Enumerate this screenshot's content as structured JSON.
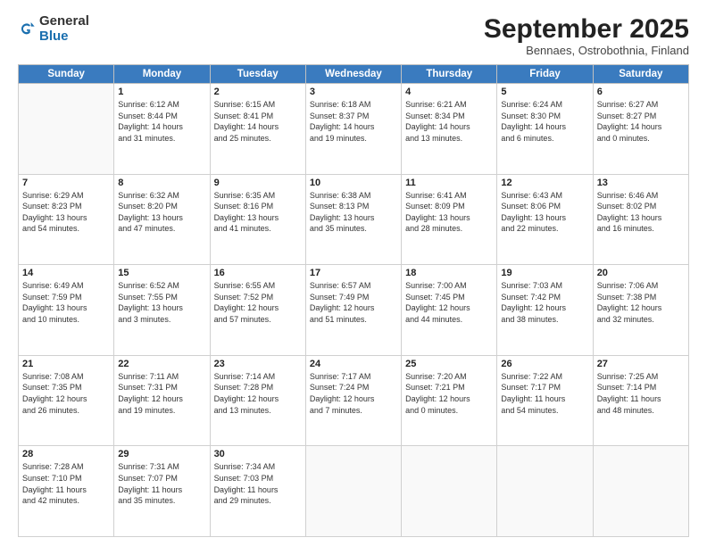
{
  "logo": {
    "general": "General",
    "blue": "Blue"
  },
  "header": {
    "month": "September 2025",
    "location": "Bennaes, Ostrobothnia, Finland"
  },
  "weekdays": [
    "Sunday",
    "Monday",
    "Tuesday",
    "Wednesday",
    "Thursday",
    "Friday",
    "Saturday"
  ],
  "weeks": [
    [
      {
        "day": "",
        "info": ""
      },
      {
        "day": "1",
        "info": "Sunrise: 6:12 AM\nSunset: 8:44 PM\nDaylight: 14 hours\nand 31 minutes."
      },
      {
        "day": "2",
        "info": "Sunrise: 6:15 AM\nSunset: 8:41 PM\nDaylight: 14 hours\nand 25 minutes."
      },
      {
        "day": "3",
        "info": "Sunrise: 6:18 AM\nSunset: 8:37 PM\nDaylight: 14 hours\nand 19 minutes."
      },
      {
        "day": "4",
        "info": "Sunrise: 6:21 AM\nSunset: 8:34 PM\nDaylight: 14 hours\nand 13 minutes."
      },
      {
        "day": "5",
        "info": "Sunrise: 6:24 AM\nSunset: 8:30 PM\nDaylight: 14 hours\nand 6 minutes."
      },
      {
        "day": "6",
        "info": "Sunrise: 6:27 AM\nSunset: 8:27 PM\nDaylight: 14 hours\nand 0 minutes."
      }
    ],
    [
      {
        "day": "7",
        "info": "Sunrise: 6:29 AM\nSunset: 8:23 PM\nDaylight: 13 hours\nand 54 minutes."
      },
      {
        "day": "8",
        "info": "Sunrise: 6:32 AM\nSunset: 8:20 PM\nDaylight: 13 hours\nand 47 minutes."
      },
      {
        "day": "9",
        "info": "Sunrise: 6:35 AM\nSunset: 8:16 PM\nDaylight: 13 hours\nand 41 minutes."
      },
      {
        "day": "10",
        "info": "Sunrise: 6:38 AM\nSunset: 8:13 PM\nDaylight: 13 hours\nand 35 minutes."
      },
      {
        "day": "11",
        "info": "Sunrise: 6:41 AM\nSunset: 8:09 PM\nDaylight: 13 hours\nand 28 minutes."
      },
      {
        "day": "12",
        "info": "Sunrise: 6:43 AM\nSunset: 8:06 PM\nDaylight: 13 hours\nand 22 minutes."
      },
      {
        "day": "13",
        "info": "Sunrise: 6:46 AM\nSunset: 8:02 PM\nDaylight: 13 hours\nand 16 minutes."
      }
    ],
    [
      {
        "day": "14",
        "info": "Sunrise: 6:49 AM\nSunset: 7:59 PM\nDaylight: 13 hours\nand 10 minutes."
      },
      {
        "day": "15",
        "info": "Sunrise: 6:52 AM\nSunset: 7:55 PM\nDaylight: 13 hours\nand 3 minutes."
      },
      {
        "day": "16",
        "info": "Sunrise: 6:55 AM\nSunset: 7:52 PM\nDaylight: 12 hours\nand 57 minutes."
      },
      {
        "day": "17",
        "info": "Sunrise: 6:57 AM\nSunset: 7:49 PM\nDaylight: 12 hours\nand 51 minutes."
      },
      {
        "day": "18",
        "info": "Sunrise: 7:00 AM\nSunset: 7:45 PM\nDaylight: 12 hours\nand 44 minutes."
      },
      {
        "day": "19",
        "info": "Sunrise: 7:03 AM\nSunset: 7:42 PM\nDaylight: 12 hours\nand 38 minutes."
      },
      {
        "day": "20",
        "info": "Sunrise: 7:06 AM\nSunset: 7:38 PM\nDaylight: 12 hours\nand 32 minutes."
      }
    ],
    [
      {
        "day": "21",
        "info": "Sunrise: 7:08 AM\nSunset: 7:35 PM\nDaylight: 12 hours\nand 26 minutes."
      },
      {
        "day": "22",
        "info": "Sunrise: 7:11 AM\nSunset: 7:31 PM\nDaylight: 12 hours\nand 19 minutes."
      },
      {
        "day": "23",
        "info": "Sunrise: 7:14 AM\nSunset: 7:28 PM\nDaylight: 12 hours\nand 13 minutes."
      },
      {
        "day": "24",
        "info": "Sunrise: 7:17 AM\nSunset: 7:24 PM\nDaylight: 12 hours\nand 7 minutes."
      },
      {
        "day": "25",
        "info": "Sunrise: 7:20 AM\nSunset: 7:21 PM\nDaylight: 12 hours\nand 0 minutes."
      },
      {
        "day": "26",
        "info": "Sunrise: 7:22 AM\nSunset: 7:17 PM\nDaylight: 11 hours\nand 54 minutes."
      },
      {
        "day": "27",
        "info": "Sunrise: 7:25 AM\nSunset: 7:14 PM\nDaylight: 11 hours\nand 48 minutes."
      }
    ],
    [
      {
        "day": "28",
        "info": "Sunrise: 7:28 AM\nSunset: 7:10 PM\nDaylight: 11 hours\nand 42 minutes."
      },
      {
        "day": "29",
        "info": "Sunrise: 7:31 AM\nSunset: 7:07 PM\nDaylight: 11 hours\nand 35 minutes."
      },
      {
        "day": "30",
        "info": "Sunrise: 7:34 AM\nSunset: 7:03 PM\nDaylight: 11 hours\nand 29 minutes."
      },
      {
        "day": "",
        "info": ""
      },
      {
        "day": "",
        "info": ""
      },
      {
        "day": "",
        "info": ""
      },
      {
        "day": "",
        "info": ""
      }
    ]
  ]
}
